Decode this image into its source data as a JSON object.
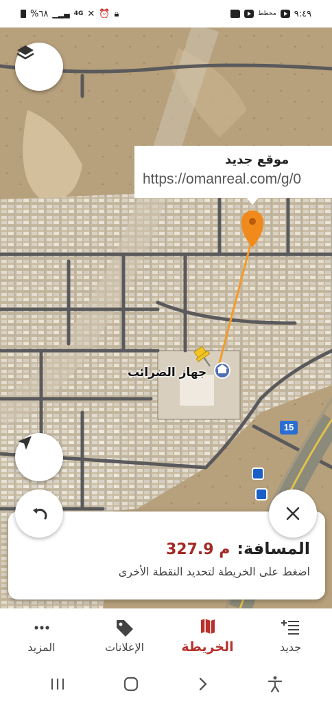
{
  "status_bar": {
    "time": "٩:٤٩",
    "battery": "%٦٨",
    "network": "4G",
    "small_label": "مخطط"
  },
  "map": {
    "callout": {
      "title": "موقع جديد",
      "url": "https://omanreal.com/g/0"
    },
    "poi_label": "جهاز الضرائب",
    "route_shield": "15",
    "icons": [
      "layers-icon",
      "navigation-arrow-icon",
      "location-pin-icon",
      "thumbtack-icon",
      "bus-stop-icon"
    ]
  },
  "distance_card": {
    "label": "المسافة:",
    "value": "327.9 م",
    "hint": "اضغط على الخريطة لتحديد النقطة الأخرى"
  },
  "bottom_nav": {
    "items": [
      {
        "label": "جديد",
        "icon": "add-list-icon"
      },
      {
        "label": "الخريطة",
        "icon": "map-icon",
        "active": true
      },
      {
        "label": "الإعلانات",
        "icon": "tag-icon"
      },
      {
        "label": "المزيد",
        "icon": "more-dots-icon"
      }
    ]
  },
  "colors": {
    "accent": "#b8312c",
    "route_line": "#f39a2a",
    "pin": "#f08a1c"
  }
}
